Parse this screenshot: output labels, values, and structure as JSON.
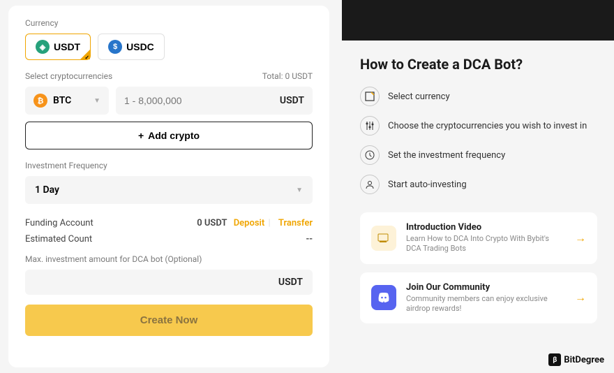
{
  "form": {
    "currency_label": "Currency",
    "currencies": [
      {
        "code": "USDT",
        "active": true
      },
      {
        "code": "USDC",
        "active": false
      }
    ],
    "select_crypto_label": "Select cryptocurrencies",
    "total_label": "Total: 0 USDT",
    "selected_coin": "BTC",
    "amount_placeholder": "1 - 8,000,000",
    "amount_unit": "USDT",
    "add_crypto_label": "Add crypto",
    "freq_label": "Investment Frequency",
    "freq_value": "1 Day",
    "funding_account_label": "Funding Account",
    "funding_account_value": "0 USDT",
    "deposit_label": "Deposit",
    "transfer_label": "Transfer",
    "estimated_count_label": "Estimated Count",
    "estimated_count_value": "--",
    "max_label": "Max. investment amount for DCA bot (Optional)",
    "max_unit": "USDT",
    "create_label": "Create Now"
  },
  "guide": {
    "title": "How to Create a DCA Bot?",
    "steps": [
      "Select currency",
      "Choose the cryptocurrencies you wish to invest in",
      "Set the investment frequency",
      "Start auto-investing"
    ],
    "cards": [
      {
        "title": "Introduction Video",
        "desc": "Learn How to DCA Into Crypto With Bybit's DCA Trading Bots"
      },
      {
        "title": "Join Our Community",
        "desc": "Community members can enjoy exclusive airdrop rewards!"
      }
    ]
  },
  "watermark": "BitDegree"
}
